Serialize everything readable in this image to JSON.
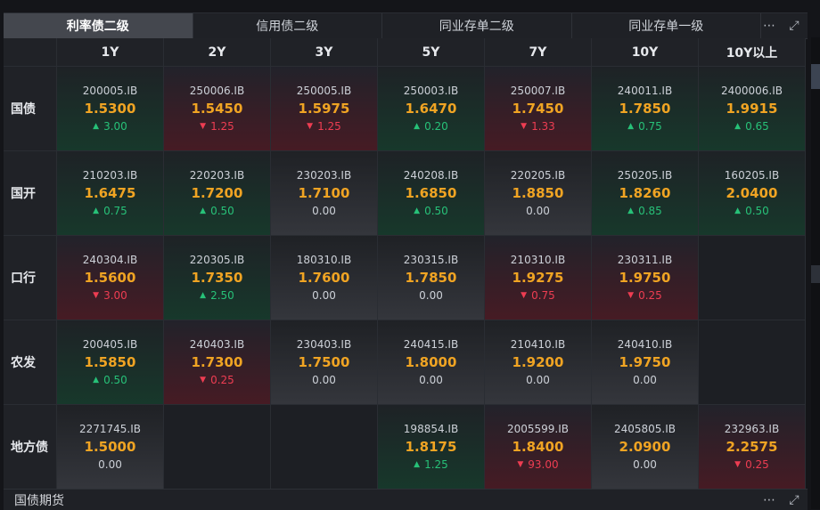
{
  "tabs": [
    "利率债二级",
    "信用债二级",
    "同业存单二级",
    "同业存单一级"
  ],
  "columns": [
    "1Y",
    "2Y",
    "3Y",
    "5Y",
    "7Y",
    "10Y",
    "10Y以上"
  ],
  "rows": [
    {
      "label": "国债",
      "cells": [
        {
          "code": "200005.IB",
          "price": "1.5300",
          "change": "3.00",
          "dir": "up"
        },
        {
          "code": "250006.IB",
          "price": "1.5450",
          "change": "1.25",
          "dir": "down"
        },
        {
          "code": "250005.IB",
          "price": "1.5975",
          "change": "1.25",
          "dir": "down"
        },
        {
          "code": "250003.IB",
          "price": "1.6470",
          "change": "0.20",
          "dir": "up"
        },
        {
          "code": "250007.IB",
          "price": "1.7450",
          "change": "1.33",
          "dir": "down"
        },
        {
          "code": "240011.IB",
          "price": "1.7850",
          "change": "0.75",
          "dir": "up"
        },
        {
          "code": "2400006.IB",
          "price": "1.9915",
          "change": "0.65",
          "dir": "up"
        }
      ]
    },
    {
      "label": "国开",
      "cells": [
        {
          "code": "210203.IB",
          "price": "1.6475",
          "change": "0.75",
          "dir": "up"
        },
        {
          "code": "220203.IB",
          "price": "1.7200",
          "change": "0.50",
          "dir": "up"
        },
        {
          "code": "230203.IB",
          "price": "1.7100",
          "change": "0.00",
          "dir": "flat"
        },
        {
          "code": "240208.IB",
          "price": "1.6850",
          "change": "0.50",
          "dir": "up"
        },
        {
          "code": "220205.IB",
          "price": "1.8850",
          "change": "0.00",
          "dir": "flat"
        },
        {
          "code": "250205.IB",
          "price": "1.8260",
          "change": "0.85",
          "dir": "up"
        },
        {
          "code": "160205.IB",
          "price": "2.0400",
          "change": "0.50",
          "dir": "up"
        }
      ]
    },
    {
      "label": "口行",
      "cells": [
        {
          "code": "240304.IB",
          "price": "1.5600",
          "change": "3.00",
          "dir": "down"
        },
        {
          "code": "220305.IB",
          "price": "1.7350",
          "change": "2.50",
          "dir": "up"
        },
        {
          "code": "180310.IB",
          "price": "1.7600",
          "change": "0.00",
          "dir": "flat"
        },
        {
          "code": "230315.IB",
          "price": "1.7850",
          "change": "0.00",
          "dir": "flat"
        },
        {
          "code": "210310.IB",
          "price": "1.9275",
          "change": "0.75",
          "dir": "down"
        },
        {
          "code": "230311.IB",
          "price": "1.9750",
          "change": "0.25",
          "dir": "down"
        },
        null
      ]
    },
    {
      "label": "农发",
      "cells": [
        {
          "code": "200405.IB",
          "price": "1.5850",
          "change": "0.50",
          "dir": "up"
        },
        {
          "code": "240403.IB",
          "price": "1.7300",
          "change": "0.25",
          "dir": "down"
        },
        {
          "code": "230403.IB",
          "price": "1.7500",
          "change": "0.00",
          "dir": "flat"
        },
        {
          "code": "240415.IB",
          "price": "1.8000",
          "change": "0.00",
          "dir": "flat"
        },
        {
          "code": "210410.IB",
          "price": "1.9200",
          "change": "0.00",
          "dir": "flat"
        },
        {
          "code": "240410.IB",
          "price": "1.9750",
          "change": "0.00",
          "dir": "flat"
        },
        null
      ]
    },
    {
      "label": "地方债",
      "cells": [
        {
          "code": "2271745.IB",
          "price": "1.5000",
          "change": "0.00",
          "dir": "flat"
        },
        null,
        null,
        {
          "code": "198854.IB",
          "price": "1.8175",
          "change": "1.25",
          "dir": "up"
        },
        {
          "code": "2005599.IB",
          "price": "1.8400",
          "change": "93.00",
          "dir": "down"
        },
        {
          "code": "2405805.IB",
          "price": "2.0900",
          "change": "0.00",
          "dir": "flat"
        },
        {
          "code": "232963.IB",
          "price": "2.2575",
          "change": "0.25",
          "dir": "down"
        }
      ]
    }
  ],
  "bottom": {
    "title": "国债期货"
  },
  "colors": {
    "up": "#27c178",
    "down": "#ee3d52",
    "price": "#f0a423"
  },
  "icons": {
    "more": "more-dots-icon",
    "expand": "expand-icon"
  }
}
